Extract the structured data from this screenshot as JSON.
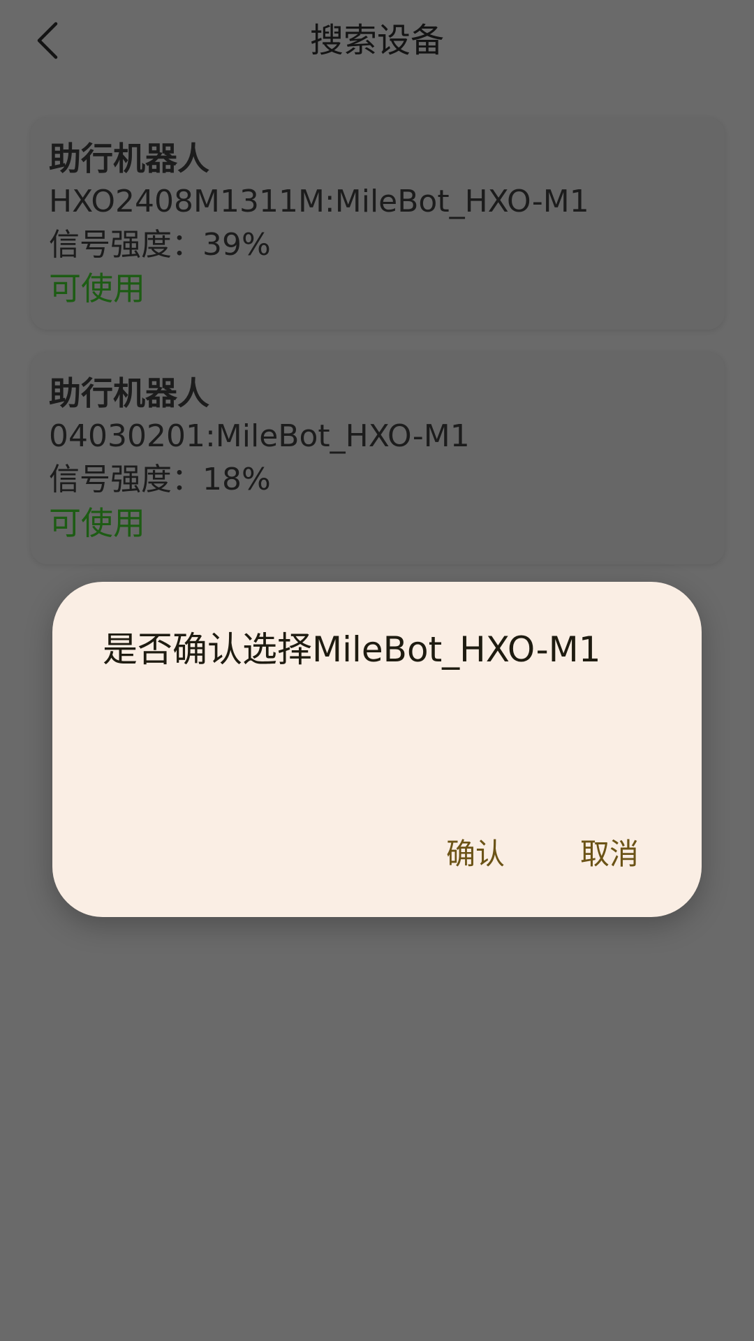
{
  "header": {
    "title": "搜索设备",
    "back_icon": "chevron-left-icon"
  },
  "devices": [
    {
      "name": "助行机器人",
      "id": "HXO2408M1311M:MileBot_HXO-M1",
      "signal": "信号强度：39%",
      "status": "可使用"
    },
    {
      "name": "助行机器人",
      "id": "04030201:MileBot_HXO-M1",
      "signal": "信号强度：18%",
      "status": "可使用"
    }
  ],
  "dialog": {
    "message": "是否确认选择MileBot_HXO-M1",
    "confirm_label": "确认",
    "cancel_label": "取消"
  },
  "colors": {
    "scrim_background": "#6a6a6a",
    "status_available": "#1d5c14",
    "dialog_background": "#faeee4",
    "dialog_button_text": "#6b5316"
  }
}
